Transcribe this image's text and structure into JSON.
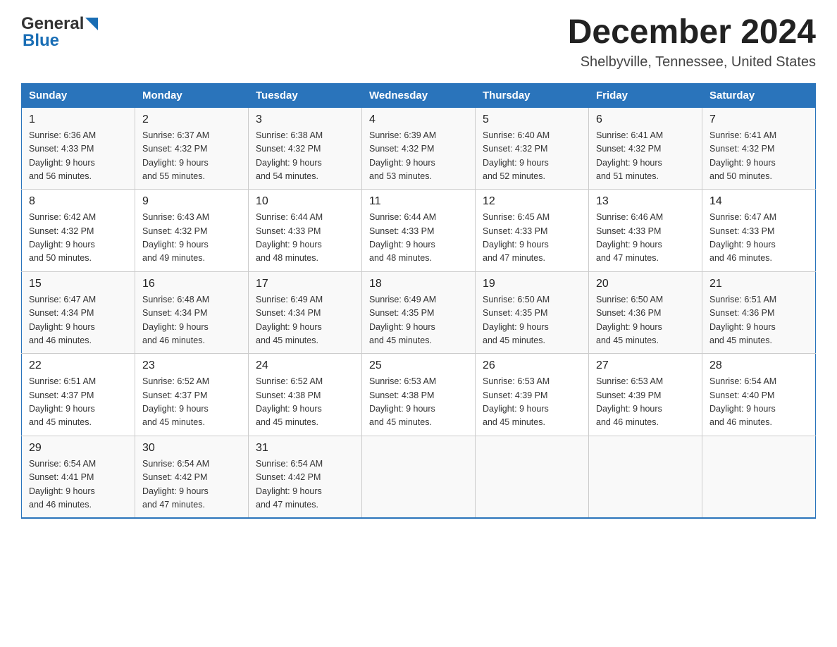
{
  "header": {
    "title": "December 2024",
    "subtitle": "Shelbyville, Tennessee, United States",
    "logo_general": "General",
    "logo_blue": "Blue"
  },
  "days_of_week": [
    "Sunday",
    "Monday",
    "Tuesday",
    "Wednesday",
    "Thursday",
    "Friday",
    "Saturday"
  ],
  "weeks": [
    [
      {
        "day": "1",
        "sunrise": "6:36 AM",
        "sunset": "4:33 PM",
        "daylight": "9 hours and 56 minutes."
      },
      {
        "day": "2",
        "sunrise": "6:37 AM",
        "sunset": "4:32 PM",
        "daylight": "9 hours and 55 minutes."
      },
      {
        "day": "3",
        "sunrise": "6:38 AM",
        "sunset": "4:32 PM",
        "daylight": "9 hours and 54 minutes."
      },
      {
        "day": "4",
        "sunrise": "6:39 AM",
        "sunset": "4:32 PM",
        "daylight": "9 hours and 53 minutes."
      },
      {
        "day": "5",
        "sunrise": "6:40 AM",
        "sunset": "4:32 PM",
        "daylight": "9 hours and 52 minutes."
      },
      {
        "day": "6",
        "sunrise": "6:41 AM",
        "sunset": "4:32 PM",
        "daylight": "9 hours and 51 minutes."
      },
      {
        "day": "7",
        "sunrise": "6:41 AM",
        "sunset": "4:32 PM",
        "daylight": "9 hours and 50 minutes."
      }
    ],
    [
      {
        "day": "8",
        "sunrise": "6:42 AM",
        "sunset": "4:32 PM",
        "daylight": "9 hours and 50 minutes."
      },
      {
        "day": "9",
        "sunrise": "6:43 AM",
        "sunset": "4:32 PM",
        "daylight": "9 hours and 49 minutes."
      },
      {
        "day": "10",
        "sunrise": "6:44 AM",
        "sunset": "4:33 PM",
        "daylight": "9 hours and 48 minutes."
      },
      {
        "day": "11",
        "sunrise": "6:44 AM",
        "sunset": "4:33 PM",
        "daylight": "9 hours and 48 minutes."
      },
      {
        "day": "12",
        "sunrise": "6:45 AM",
        "sunset": "4:33 PM",
        "daylight": "9 hours and 47 minutes."
      },
      {
        "day": "13",
        "sunrise": "6:46 AM",
        "sunset": "4:33 PM",
        "daylight": "9 hours and 47 minutes."
      },
      {
        "day": "14",
        "sunrise": "6:47 AM",
        "sunset": "4:33 PM",
        "daylight": "9 hours and 46 minutes."
      }
    ],
    [
      {
        "day": "15",
        "sunrise": "6:47 AM",
        "sunset": "4:34 PM",
        "daylight": "9 hours and 46 minutes."
      },
      {
        "day": "16",
        "sunrise": "6:48 AM",
        "sunset": "4:34 PM",
        "daylight": "9 hours and 46 minutes."
      },
      {
        "day": "17",
        "sunrise": "6:49 AM",
        "sunset": "4:34 PM",
        "daylight": "9 hours and 45 minutes."
      },
      {
        "day": "18",
        "sunrise": "6:49 AM",
        "sunset": "4:35 PM",
        "daylight": "9 hours and 45 minutes."
      },
      {
        "day": "19",
        "sunrise": "6:50 AM",
        "sunset": "4:35 PM",
        "daylight": "9 hours and 45 minutes."
      },
      {
        "day": "20",
        "sunrise": "6:50 AM",
        "sunset": "4:36 PM",
        "daylight": "9 hours and 45 minutes."
      },
      {
        "day": "21",
        "sunrise": "6:51 AM",
        "sunset": "4:36 PM",
        "daylight": "9 hours and 45 minutes."
      }
    ],
    [
      {
        "day": "22",
        "sunrise": "6:51 AM",
        "sunset": "4:37 PM",
        "daylight": "9 hours and 45 minutes."
      },
      {
        "day": "23",
        "sunrise": "6:52 AM",
        "sunset": "4:37 PM",
        "daylight": "9 hours and 45 minutes."
      },
      {
        "day": "24",
        "sunrise": "6:52 AM",
        "sunset": "4:38 PM",
        "daylight": "9 hours and 45 minutes."
      },
      {
        "day": "25",
        "sunrise": "6:53 AM",
        "sunset": "4:38 PM",
        "daylight": "9 hours and 45 minutes."
      },
      {
        "day": "26",
        "sunrise": "6:53 AM",
        "sunset": "4:39 PM",
        "daylight": "9 hours and 45 minutes."
      },
      {
        "day": "27",
        "sunrise": "6:53 AM",
        "sunset": "4:39 PM",
        "daylight": "9 hours and 46 minutes."
      },
      {
        "day": "28",
        "sunrise": "6:54 AM",
        "sunset": "4:40 PM",
        "daylight": "9 hours and 46 minutes."
      }
    ],
    [
      {
        "day": "29",
        "sunrise": "6:54 AM",
        "sunset": "4:41 PM",
        "daylight": "9 hours and 46 minutes."
      },
      {
        "day": "30",
        "sunrise": "6:54 AM",
        "sunset": "4:42 PM",
        "daylight": "9 hours and 47 minutes."
      },
      {
        "day": "31",
        "sunrise": "6:54 AM",
        "sunset": "4:42 PM",
        "daylight": "9 hours and 47 minutes."
      },
      null,
      null,
      null,
      null
    ]
  ],
  "labels": {
    "sunrise": "Sunrise:",
    "sunset": "Sunset:",
    "daylight": "Daylight:"
  }
}
